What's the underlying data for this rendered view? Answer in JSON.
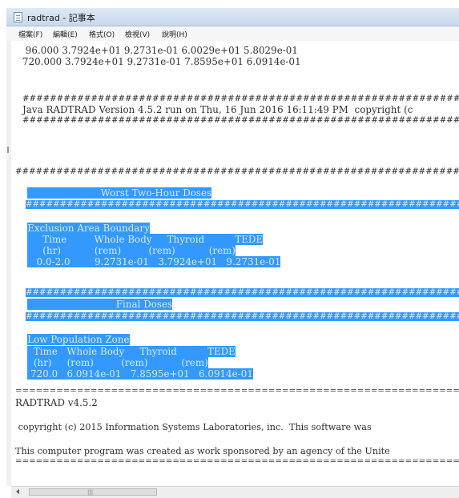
{
  "window": {
    "title": "radtrad - 記事本"
  },
  "menu": [
    "檔案(F)",
    "編輯(E)",
    "格式(O)",
    "檢視(V)",
    "說明(H)"
  ],
  "editor": {
    "line1": " 96.000 3.7924e+01 9.2731e-01 6.0029e+01 5.8029e-01",
    "line2": "720.000 3.7924e+01 9.2731e-01 7.8595e+01 6.0914e-01",
    "hash_top": "#######################################################################",
    "java_line": "Java RADTRAD Version 4.5.2 run on Thu, 16 Jun 2016 16:11:49 PM  copyright (c",
    "hash_bottom": "#######################################################################",
    "worst_hash_top": "######################################################################",
    "worst_title": "                        Worst Two-Hour Doses",
    "worst_hash_bottom": "######################################################################",
    "eab_label": "Exclusion Area Boundary",
    "eab_header": "     Time         Whole Body     Thyroid          TEDE",
    "eab_units": "     (hr)           (rem)         (rem)           (rem)",
    "eab_values": "   0.0-2.0        9.2731e-01   3.7924e+01   9.2731e-01",
    "final_hash_top": "######################################################################",
    "final_title": "                             Final Doses",
    "final_hash_bottom": "######################################################################",
    "lpz_label": "Low Population Zone",
    "lpz_header": "  Time   Whole Body     Thyroid          TEDE",
    "lpz_units": "  (hr)     (rem)         (rem)           (rem)",
    "lpz_values": " 720.0   6.0914e-01   7.8595e+01   6.0914e-01",
    "eq_top": "===========================================================================",
    "version": "RADTRAD v4.5.2",
    "copyright_line": " copyright (c) 2015 Information Systems Laboratories, inc.  This software was",
    "program_line": "This computer program was created as work sponsored by an agency of the Unite",
    "eq_bottom": "==========================================================================="
  },
  "scrollbar": {
    "grip": "|||"
  }
}
